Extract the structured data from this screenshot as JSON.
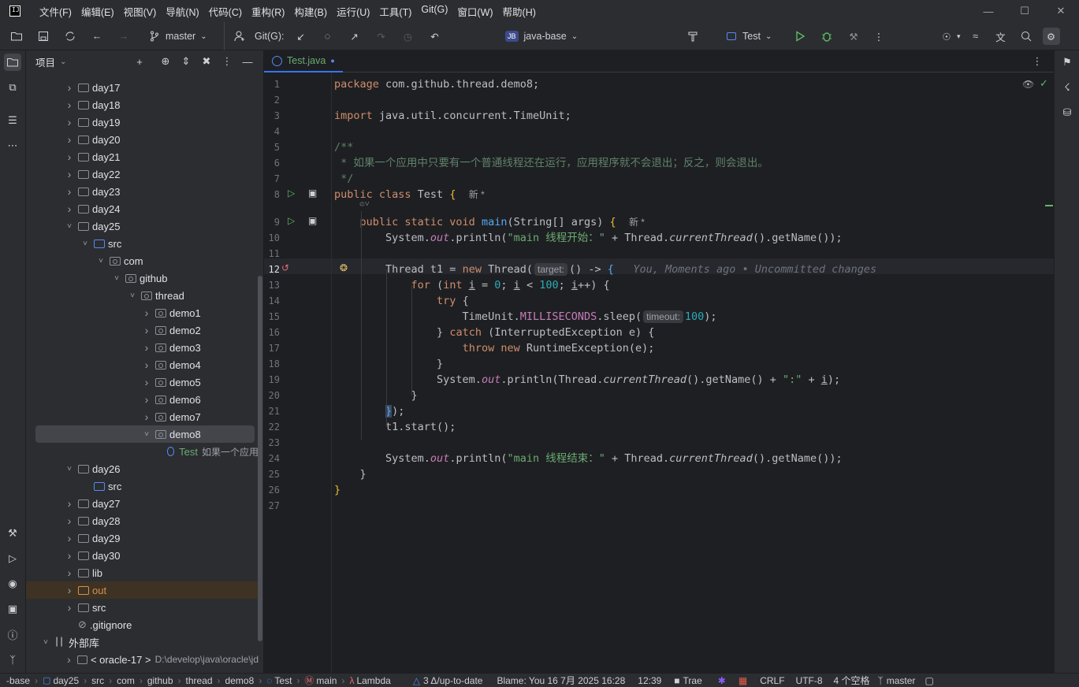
{
  "menu": [
    "文件(F)",
    "编辑(E)",
    "视图(V)",
    "导航(N)",
    "代码(C)",
    "重构(R)",
    "构建(B)",
    "运行(U)",
    "工具(T)",
    "Git(G)",
    "窗口(W)",
    "帮助(H)"
  ],
  "toolbar": {
    "branch": "master",
    "git_label": "Git(G):",
    "project_badge": "JB",
    "project_name": "java-base",
    "run_config": "Test"
  },
  "project_panel": {
    "title": "项目"
  },
  "tree": [
    {
      "label": "day17",
      "indent": 1,
      "chev": ">",
      "icon": "folder"
    },
    {
      "label": "day18",
      "indent": 1,
      "chev": ">",
      "icon": "folder"
    },
    {
      "label": "day19",
      "indent": 1,
      "chev": ">",
      "icon": "folder"
    },
    {
      "label": "day20",
      "indent": 1,
      "chev": ">",
      "icon": "folder"
    },
    {
      "label": "day21",
      "indent": 1,
      "chev": ">",
      "icon": "folder"
    },
    {
      "label": "day22",
      "indent": 1,
      "chev": ">",
      "icon": "folder"
    },
    {
      "label": "day23",
      "indent": 1,
      "chev": ">",
      "icon": "folder"
    },
    {
      "label": "day24",
      "indent": 1,
      "chev": ">",
      "icon": "folder"
    },
    {
      "label": "day25",
      "indent": 1,
      "chev": "v",
      "icon": "folder"
    },
    {
      "label": "src",
      "indent": 2,
      "chev": "v",
      "icon": "src"
    },
    {
      "label": "com",
      "indent": 3,
      "chev": "v",
      "icon": "pkg"
    },
    {
      "label": "github",
      "indent": 4,
      "chev": "v",
      "icon": "pkg"
    },
    {
      "label": "thread",
      "indent": 5,
      "chev": "v",
      "icon": "pkg"
    },
    {
      "label": "demo1",
      "indent": 6,
      "chev": ">",
      "icon": "pkg"
    },
    {
      "label": "demo2",
      "indent": 6,
      "chev": ">",
      "icon": "pkg"
    },
    {
      "label": "demo3",
      "indent": 6,
      "chev": ">",
      "icon": "pkg"
    },
    {
      "label": "demo4",
      "indent": 6,
      "chev": ">",
      "icon": "pkg"
    },
    {
      "label": "demo5",
      "indent": 6,
      "chev": ">",
      "icon": "pkg"
    },
    {
      "label": "demo6",
      "indent": 6,
      "chev": ">",
      "icon": "pkg"
    },
    {
      "label": "demo7",
      "indent": 6,
      "chev": ">",
      "icon": "pkg"
    },
    {
      "label": "demo8",
      "indent": 6,
      "chev": "v",
      "icon": "pkg"
    },
    {
      "label": "Test",
      "indent": 7,
      "chev": "",
      "icon": "class",
      "extra": "如果一个应用"
    },
    {
      "label": "day26",
      "indent": 1,
      "chev": "v",
      "icon": "folder"
    },
    {
      "label": "src",
      "indent": 2,
      "chev": "",
      "icon": "src"
    },
    {
      "label": "day27",
      "indent": 1,
      "chev": ">",
      "icon": "folder"
    },
    {
      "label": "day28",
      "indent": 1,
      "chev": ">",
      "icon": "folder"
    },
    {
      "label": "day29",
      "indent": 1,
      "chev": ">",
      "icon": "folder"
    },
    {
      "label": "day30",
      "indent": 1,
      "chev": ">",
      "icon": "folder"
    },
    {
      "label": "lib",
      "indent": 1,
      "chev": ">",
      "icon": "folder"
    },
    {
      "label": "out",
      "indent": 1,
      "chev": ">",
      "icon": "out"
    },
    {
      "label": "src",
      "indent": 1,
      "chev": ">",
      "icon": "folder"
    },
    {
      "label": ".gitignore",
      "indent": 1,
      "chev": "",
      "icon": "ignore"
    },
    {
      "label": "外部库",
      "indent": 0,
      "chev": "v",
      "icon": "lib"
    },
    {
      "label": "< oracle-17 >",
      "indent": 1,
      "chev": ">",
      "icon": "folder",
      "extra": "D:\\develop\\java\\oracle\\jd"
    }
  ],
  "editor_tab": {
    "name": "Test.java"
  },
  "code_lines": [
    "package com.github.thread.demo8;",
    "",
    "import java.util.concurrent.TimeUnit;",
    "",
    "/**",
    " * 如果一个应用中只要有一个普通线程还在运行，应用程序就不会退出；反之，则会退出。",
    " */",
    "public class Test {",
    "public static void main(String[] args) {",
    "System.out.println(\"main 线程开始：\" + Thread.currentThread().getName());",
    "",
    "Thread t1 = new Thread(() -> {",
    "for (int i = 0; i < 100; i++) {",
    "try {",
    "TimeUnit.MILLISECONDS.sleep(100);",
    "} catch (InterruptedException e) {",
    "throw new RuntimeException(e);",
    "}",
    "System.out.println(Thread.currentThread().getName() + \":\" + i);",
    "}",
    "});",
    "t1.start();",
    "",
    "System.out.println(\"main 线程结束：\" + Thread.currentThread().getName());",
    "}",
    "}",
    ""
  ],
  "inlay": {
    "new_label": "新 *",
    "target_hint": "target:",
    "timeout_hint": "timeout:",
    "blame": "You, Moments ago • Uncommitted changes"
  },
  "status": {
    "crumbs": [
      "-base",
      "day25",
      "src",
      "com",
      "github",
      "thread",
      "demo8",
      "Test",
      "main",
      "Lambda"
    ],
    "vcs": "3 Δ/up-to-date",
    "blame": "Blame: You 16 7月 2025 16:28",
    "pos": "12:39",
    "trae": "Trae",
    "eol": "CRLF",
    "enc": "UTF-8",
    "indent": "4 个空格",
    "branch": "master"
  },
  "colors": {
    "accent": "#3574f0",
    "bg": "#1e1f22",
    "panel": "#2b2d30"
  }
}
